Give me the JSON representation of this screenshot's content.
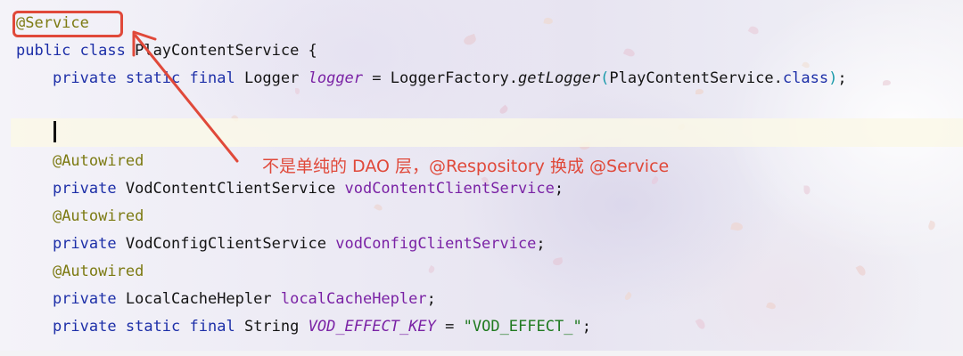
{
  "editor": {
    "lines": [
      {
        "tokens": [
          {
            "t": "@Service",
            "c": "ann"
          }
        ]
      },
      {
        "tokens": [
          {
            "t": "public",
            "c": "kw"
          },
          {
            "t": " "
          },
          {
            "t": "class",
            "c": "kw"
          },
          {
            "t": " PlayContentService {"
          }
        ]
      },
      {
        "tokens": [
          {
            "t": "    "
          },
          {
            "t": "private",
            "c": "kw"
          },
          {
            "t": " "
          },
          {
            "t": "static",
            "c": "kw"
          },
          {
            "t": " "
          },
          {
            "t": "final",
            "c": "kw"
          },
          {
            "t": " Logger "
          },
          {
            "t": "logger",
            "c": "sfld"
          },
          {
            "t": " = LoggerFactory."
          },
          {
            "t": "getLogger",
            "c": "mth"
          },
          {
            "t": "(",
            "c": "paren-hl"
          },
          {
            "t": "PlayContentService."
          },
          {
            "t": "class",
            "c": "kw"
          },
          {
            "t": ")",
            "c": "paren-hl"
          },
          {
            "t": ";"
          }
        ]
      },
      {
        "tokens": []
      },
      {
        "tokens": []
      },
      {
        "tokens": [
          {
            "t": "    "
          },
          {
            "t": "@Autowired",
            "c": "ann"
          }
        ]
      },
      {
        "tokens": [
          {
            "t": "    "
          },
          {
            "t": "private",
            "c": "kw"
          },
          {
            "t": " VodContentClientService "
          },
          {
            "t": "vodContentClientService",
            "c": "fld"
          },
          {
            "t": ";"
          }
        ]
      },
      {
        "tokens": [
          {
            "t": "    "
          },
          {
            "t": "@Autowired",
            "c": "ann"
          }
        ]
      },
      {
        "tokens": [
          {
            "t": "    "
          },
          {
            "t": "private",
            "c": "kw"
          },
          {
            "t": " VodConfigClientService "
          },
          {
            "t": "vodConfigClientService",
            "c": "fld"
          },
          {
            "t": ";"
          }
        ]
      },
      {
        "tokens": [
          {
            "t": "    "
          },
          {
            "t": "@Autowired",
            "c": "ann"
          }
        ]
      },
      {
        "tokens": [
          {
            "t": "    "
          },
          {
            "t": "private",
            "c": "kw"
          },
          {
            "t": " LocalCacheHepler "
          },
          {
            "t": "localCacheHepler",
            "c": "fld"
          },
          {
            "t": ";"
          }
        ]
      },
      {
        "tokens": [
          {
            "t": "    "
          },
          {
            "t": "private",
            "c": "kw"
          },
          {
            "t": " "
          },
          {
            "t": "static",
            "c": "kw"
          },
          {
            "t": " "
          },
          {
            "t": "final",
            "c": "kw"
          },
          {
            "t": " String "
          },
          {
            "t": "VOD_EFFECT_KEY",
            "c": "sfld"
          },
          {
            "t": " = "
          },
          {
            "t": "\"VOD_EFFECT_\"",
            "c": "str"
          },
          {
            "t": ";"
          }
        ]
      }
    ]
  },
  "annotation": {
    "text": "不是单纯的 DAO 层，@Respository 换成 @Service",
    "color": "#e0493a"
  },
  "colors": {
    "keyword": "#1d2fa8",
    "annotation": "#7c7a12",
    "field": "#7a22a5",
    "string": "#1f7a1f",
    "highlight_box": "#e0493a"
  }
}
